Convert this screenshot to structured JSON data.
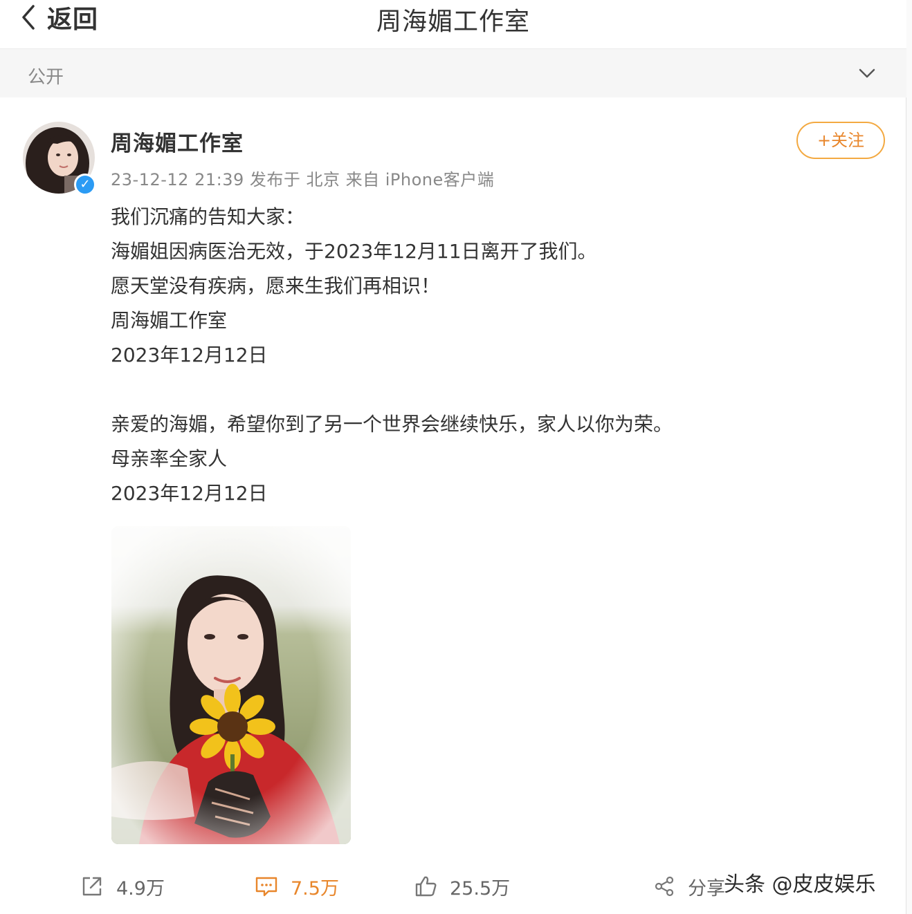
{
  "nav": {
    "back_label": "返回",
    "title": "周海媚工作室"
  },
  "visibility": {
    "label": "公开"
  },
  "post": {
    "author": "周海媚工作室",
    "verified": true,
    "meta": "23-12-12 21:39 发布于 北京 来自 iPhone客户端",
    "follow_label": "+关注",
    "lines": [
      "我们沉痛的告知大家：",
      "海媚姐因病医治无效，于2023年12月11日离开了我们。",
      "愿天堂没有疾病，愿来生我们再相识！",
      "周海媚工作室",
      "2023年12月12日",
      "",
      "亲爱的海媚，希望你到了另一个世界会继续快乐，家人以你为荣。",
      "母亲率全家人",
      "2023年12月12日"
    ]
  },
  "actions": {
    "repost": {
      "icon": "repost-icon",
      "count": "4.9万"
    },
    "comment": {
      "icon": "comment-icon",
      "count": "7.5万"
    },
    "like": {
      "icon": "thumbs-up-icon",
      "count": "25.5万"
    },
    "share": {
      "icon": "share-icon",
      "label": "分享"
    }
  },
  "watermark": "头条 @皮皮娱乐",
  "colors": {
    "accent": "#e8862b",
    "follow_border": "#f3a941",
    "verified": "#2b9bf4",
    "text": "#333333",
    "muted": "#888888"
  }
}
